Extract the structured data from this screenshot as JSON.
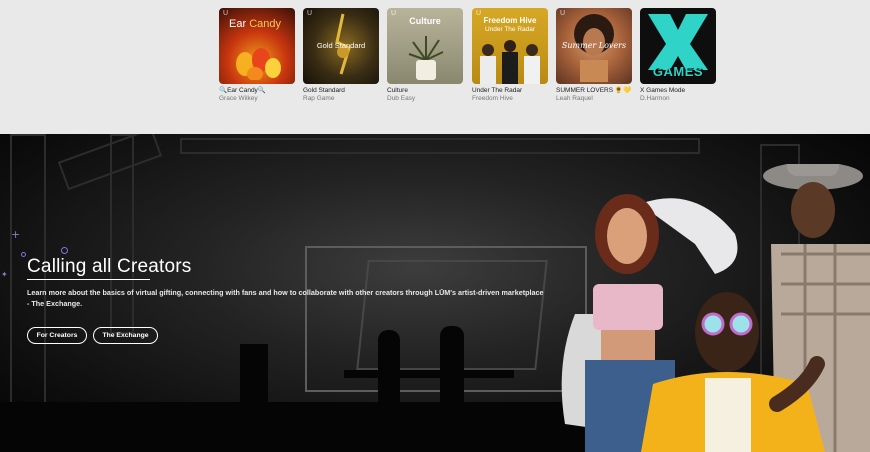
{
  "playlists": [
    {
      "cover_title": "Ear Candy",
      "cover_title_colored": "Candy",
      "cover_title_plain": "Ear ",
      "name": "🔍Ear Candy🔍",
      "artist": "Grace Wilkey"
    },
    {
      "cover_title": "Gold Standard",
      "name": "Gold Standard",
      "artist": "Rap Game"
    },
    {
      "cover_title": "Culture",
      "name": "Culture",
      "artist": "Dub Easy"
    },
    {
      "cover_title": "Freedom Hive",
      "cover_subtitle": "Under The Radar",
      "name": "Under The Radar",
      "artist": "Freedom Hive"
    },
    {
      "cover_title": "Summer Lovers",
      "name": "SUMMER LOVERS 🌻💛",
      "artist": "Leah Raquel"
    },
    {
      "cover_title": "GAMES",
      "name": "X Games Mode",
      "artist": "D.Harmon"
    }
  ],
  "cover_badge": "U",
  "hero": {
    "title": "Calling all Creators",
    "body": "Learn more about the basics of virtual gifting, connecting with fans and how to collaborate with other creators through LŪM's artist-driven marketplace - The Exchange.",
    "buttons": {
      "for_creators": "For Creators",
      "the_exchange": "The Exchange"
    }
  },
  "colors": {
    "strip_bg": "#e9e9ea",
    "accent_purple": "#8a6de0",
    "games_teal": "#2fd3c8"
  }
}
